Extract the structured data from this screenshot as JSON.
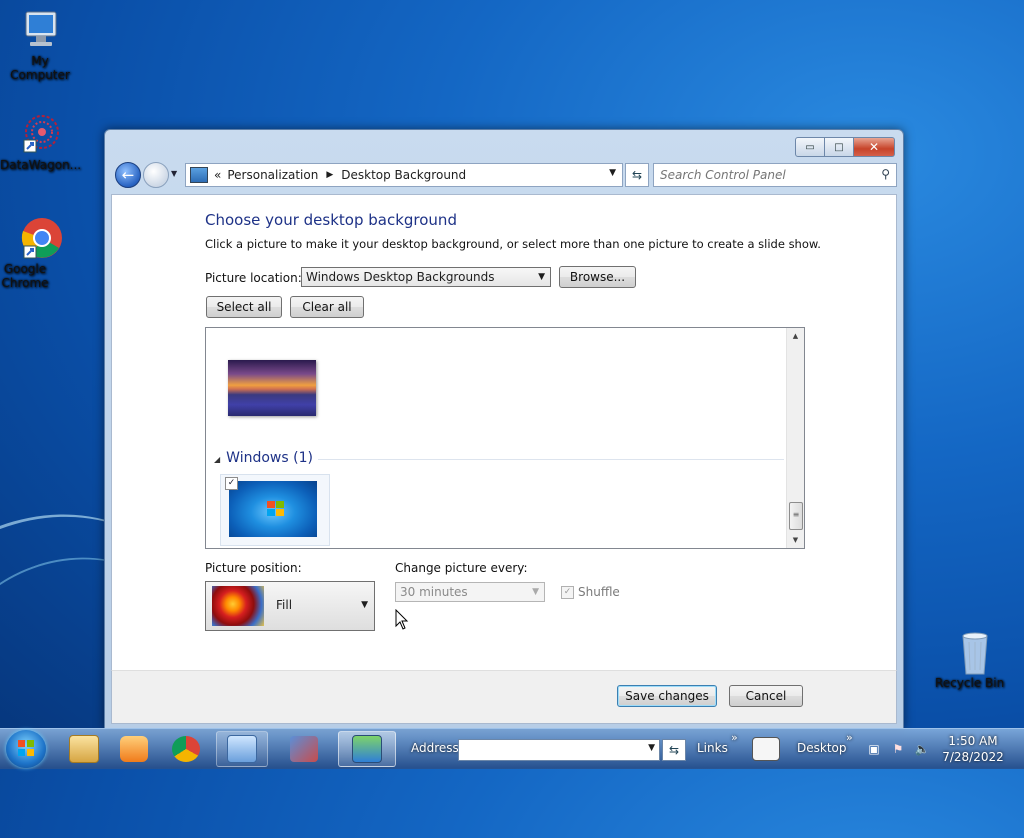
{
  "desktop": {
    "icons": [
      {
        "label": "My Computer"
      },
      {
        "label": "DataWagon..."
      },
      {
        "label": "Google Chrome"
      },
      {
        "label": "Recycle Bin"
      }
    ]
  },
  "window": {
    "controls": {
      "minimize": "▭",
      "maximize": "□",
      "close": "✕"
    },
    "nav": {
      "back": "←",
      "breadcrumb_prefix": "«",
      "crumbs": [
        "Personalization",
        "Desktop Background"
      ],
      "search_placeholder": "Search Control Panel"
    },
    "heading": "Choose your desktop background",
    "description": "Click a picture to make it your desktop background, or select more than one picture to create a slide show.",
    "picture_location_label": "Picture location:",
    "picture_location_value": "Windows Desktop Backgrounds",
    "browse_label": "Browse...",
    "select_all_label": "Select all",
    "clear_all_label": "Clear all",
    "gallery": {
      "group_title": "Windows (1)",
      "second_thumb_checked": true
    },
    "picture_position_label": "Picture position:",
    "picture_position_value": "Fill",
    "change_every_label": "Change picture every:",
    "change_every_value": "30 minutes",
    "shuffle_label": "Shuffle",
    "shuffle_checked": true,
    "save_label": "Save changes",
    "cancel_label": "Cancel"
  },
  "taskbar": {
    "address_label": "Address",
    "links_label": "Links",
    "desktop_label": "Desktop",
    "chevrons": "»",
    "time": "1:50 AM",
    "date": "7/28/2022"
  },
  "colors": {
    "heading": "#1e3287",
    "desktop_bg": "#1467c4",
    "close_button": "#c7432a"
  }
}
